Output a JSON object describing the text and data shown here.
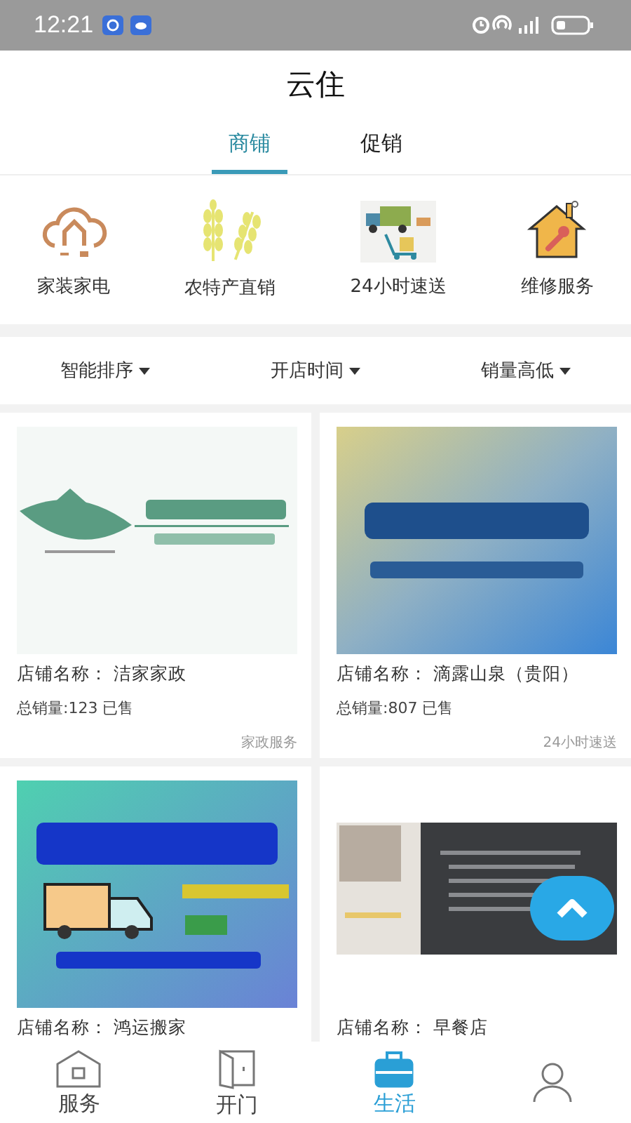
{
  "status_bar": {
    "time": "12:21"
  },
  "header": {
    "title": "云住"
  },
  "tabs": [
    {
      "label": "商铺",
      "selected": true
    },
    {
      "label": "促销",
      "selected": false
    }
  ],
  "categories": [
    {
      "label": "家装家电"
    },
    {
      "label": "农特产直销"
    },
    {
      "label": "24小时速送"
    },
    {
      "label": "维修服务"
    }
  ],
  "sort_options": [
    {
      "label": "智能排序"
    },
    {
      "label": "开店时间"
    },
    {
      "label": "销量高低"
    }
  ],
  "shops": [
    {
      "name": "店铺名称：  洁家家政",
      "sales": "总销量:123 已售",
      "category": "家政服务"
    },
    {
      "name": "店铺名称：  滴露山泉（贵阳）",
      "sales": "总销量:807 已售",
      "category": "24小时速送"
    },
    {
      "name": "店铺名称：  鸿运搬家"
    },
    {
      "name": "店铺名称：  早餐店"
    }
  ],
  "bottom_nav": [
    {
      "label": "服务",
      "selected": false
    },
    {
      "label": "开门",
      "selected": false
    },
    {
      "label": "生活",
      "selected": true
    },
    {
      "selected": false
    }
  ]
}
